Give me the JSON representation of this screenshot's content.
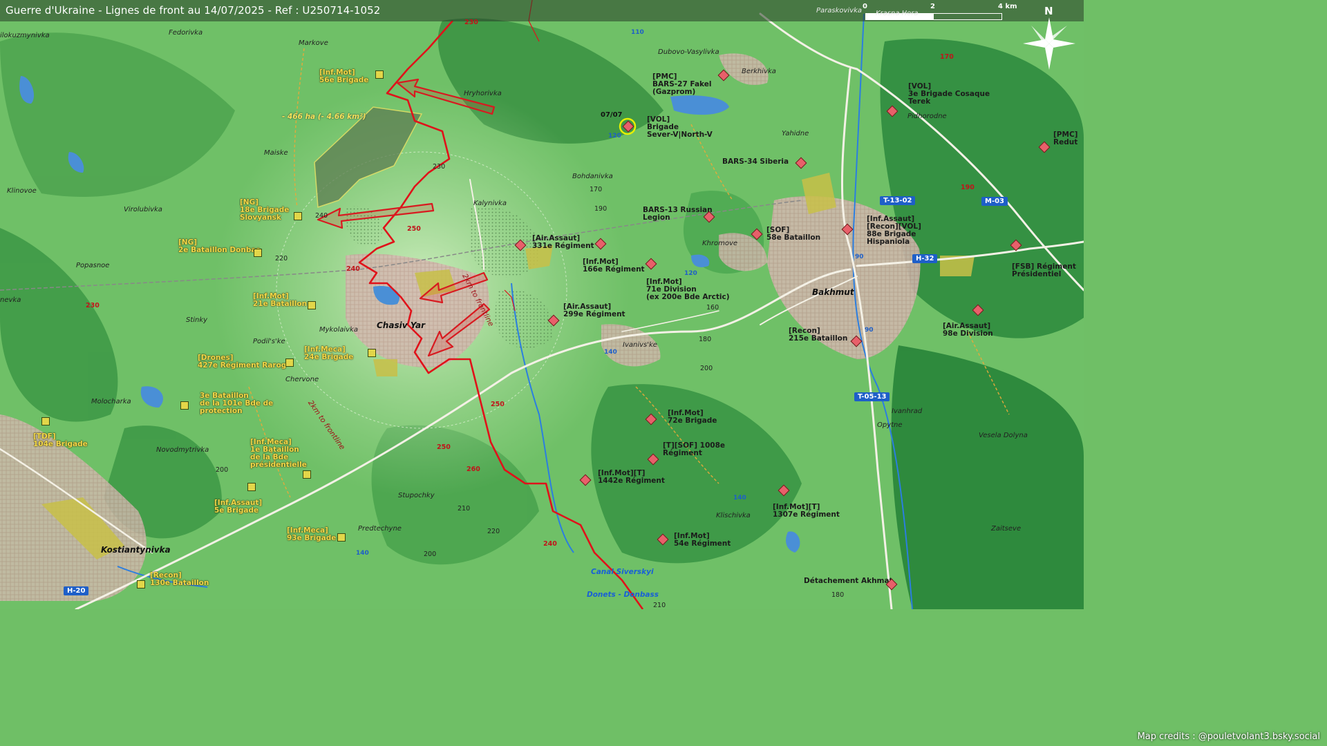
{
  "title": "Guerre d'Ukraine - Lignes de front au 14/07/2025 - Ref : U250714-1052",
  "credits": "Map credits : @pouletvolant3.bsky.social",
  "colors": {
    "russian": "#e8606a",
    "ukrainian": "#e2d649",
    "front": "#e0121a",
    "road_badge": "#1e5fc8"
  },
  "scale": {
    "zero": "0",
    "mid": "2",
    "end": "4 km"
  },
  "north": "N",
  "road_badges": {
    "t1302": "T-13-02",
    "m03": "M-03",
    "h32": "H-32",
    "t0513": "T-05-13",
    "h20": "H-20"
  },
  "road_numbers": {
    "r110": "110",
    "r120a": "120",
    "r120b": "120",
    "r140a": "140",
    "r140b": "140",
    "r140c": "140",
    "r90a": "90",
    "r90b": "90"
  },
  "settlements": {
    "ilokuzmynivka": "ilokuzmynivka",
    "fedorivka": "Fedorivka",
    "markove": "Markove",
    "paraskovivka": "Paraskovivka",
    "krasna_hora": "Krasna Hora",
    "dubovo": "Dubovo-Vasylivka",
    "berkhivka": "Berkhivka",
    "hryhorivka": "Hryhorivka",
    "pidhorodne": "Pidhorodne",
    "yahidne": "Yahidne",
    "maiske": "Maiske",
    "klinovoe": "Klinovoe",
    "virolubivka": "Virolubivka",
    "bohdanivka": "Bohdanivka",
    "kalynivka": "Kalynivka",
    "popasnoe": "Popasnoe",
    "khromove": "Khromove",
    "nevka": "nevka",
    "stinky": "Stinky",
    "mykolaivka": "Mykolaivka",
    "podilske": "Podil's'ke",
    "ivanivske": "Ivanivs'ke",
    "chervone": "Chervone",
    "molocharka": "Molocharka",
    "novodmytrivka": "Novodmytrivka",
    "ivanhrad": "Ivanhrad",
    "opytne": "Opytne",
    "vesela_dolyna": "Vesela Dolyna",
    "stupochky": "Stupochky",
    "predtechyne": "Predtechyne",
    "klischivka": "Klischivka",
    "zaitseve": "Zaitseve",
    "chasiv_yar": "Chasiv Yar",
    "bakhmut": "Bakhmut",
    "kostiantynivka": "Kostiantynivka"
  },
  "elevations": {
    "e230a": "230",
    "e230b": "230",
    "e230c": "230",
    "e240a": "240",
    "e240b": "240",
    "e240c": "240",
    "e250a": "250",
    "e250b": "250",
    "e250c": "250",
    "e260": "260",
    "e220a": "220",
    "e220b": "220",
    "e200a": "200",
    "e200b": "200",
    "e200c": "200",
    "e210a": "210",
    "e210b": "210",
    "e170a": "170",
    "e170b": "170",
    "e190a": "190",
    "e190b": "190",
    "e180a": "180",
    "e180b": "180",
    "e160": "160"
  },
  "frontline_labels": {
    "f1": "2km to frontline",
    "f2": "2km to frontline"
  },
  "canal": {
    "line1": "Canal Siverskyi",
    "line2": "Donets - Donbass"
  },
  "area_loss": "- 466 ha (- 4.66 km²)",
  "date_marker": "07/07",
  "units_russian": [
    {
      "id": "bars27",
      "text": "[PMC]\nBARS-27 Fakel\n(Gazprom)"
    },
    {
      "id": "vol3",
      "text": "[VOL]\n3e Brigade Cosaque\nTerek"
    },
    {
      "id": "pmc_redut",
      "text": "[PMC]\nRedut"
    },
    {
      "id": "sever",
      "text": "[VOL]\nBrigade\nSever-V|North-V"
    },
    {
      "id": "bars34",
      "text": "BARS-34 Siberia"
    },
    {
      "id": "bars13",
      "text": "BARS-13 Russian\nLegion"
    },
    {
      "id": "sof58",
      "text": "[SOF]\n58e Bataillon"
    },
    {
      "id": "hisp",
      "text": "[Inf.Assaut]\n[Recon][VOL]\n88e Brigade\nHispaniola"
    },
    {
      "id": "air331",
      "text": "[Air.Assaut]\n331e Régiment"
    },
    {
      "id": "inf166",
      "text": "[Inf.Mot]\n166e Régiment"
    },
    {
      "id": "inf71",
      "text": "[Inf.Mot]\n71e Division\n(ex 200e Bde Arctic)"
    },
    {
      "id": "fsb",
      "text": "[FSB] Régiment\nPrésidentiel"
    },
    {
      "id": "air299",
      "text": "[Air.Assaut]\n299e Régiment"
    },
    {
      "id": "recon215",
      "text": "[Recon]\n215e Bataillon"
    },
    {
      "id": "air98",
      "text": "[Air.Assaut]\n98e Division"
    },
    {
      "id": "inf72",
      "text": "[Inf.Mot]\n72e Brigade"
    },
    {
      "id": "sof1008",
      "text": "[T][SOF] 1008e\nRégiment"
    },
    {
      "id": "inf1442",
      "text": "[Inf.Mot][T]\n1442e Régiment"
    },
    {
      "id": "inf1307",
      "text": "[Inf.Mot][T]\n1307e Régiment"
    },
    {
      "id": "inf54",
      "text": "[Inf.Mot]\n54e Régiment"
    },
    {
      "id": "akhmat",
      "text": "Détachement Akhmat"
    }
  ],
  "units_ukrainian": [
    {
      "id": "inf56",
      "text": "[Inf.Mot]\n56e Brigade"
    },
    {
      "id": "ng18",
      "text": "[NG]\n18e Brigade\nSlovyansk"
    },
    {
      "id": "ng2",
      "text": "[NG]\n2e Bataillon Donbas"
    },
    {
      "id": "inf21",
      "text": "[Inf.Mot]\n21e Bataillon"
    },
    {
      "id": "meca24",
      "text": "[Inf.Meca]\n24e Brigade"
    },
    {
      "id": "drones427",
      "text": "[Drones]\n427e Régiment Rarog"
    },
    {
      "id": "bat3",
      "text": "3e Bataillon\nde la 101e Bde de\nprotection"
    },
    {
      "id": "tdf104",
      "text": "[TDF]\n104e Brigade"
    },
    {
      "id": "meca1",
      "text": "[Inf.Meca]\n1e Bataillon\nde la Bde\nprésidentielle"
    },
    {
      "id": "assaut5",
      "text": "[Inf.Assaut]\n5e Brigade"
    },
    {
      "id": "meca93",
      "text": "[Inf.Meca]\n93e Brigade"
    },
    {
      "id": "recon130",
      "text": "[Recon]\n130e Bataillon"
    }
  ]
}
